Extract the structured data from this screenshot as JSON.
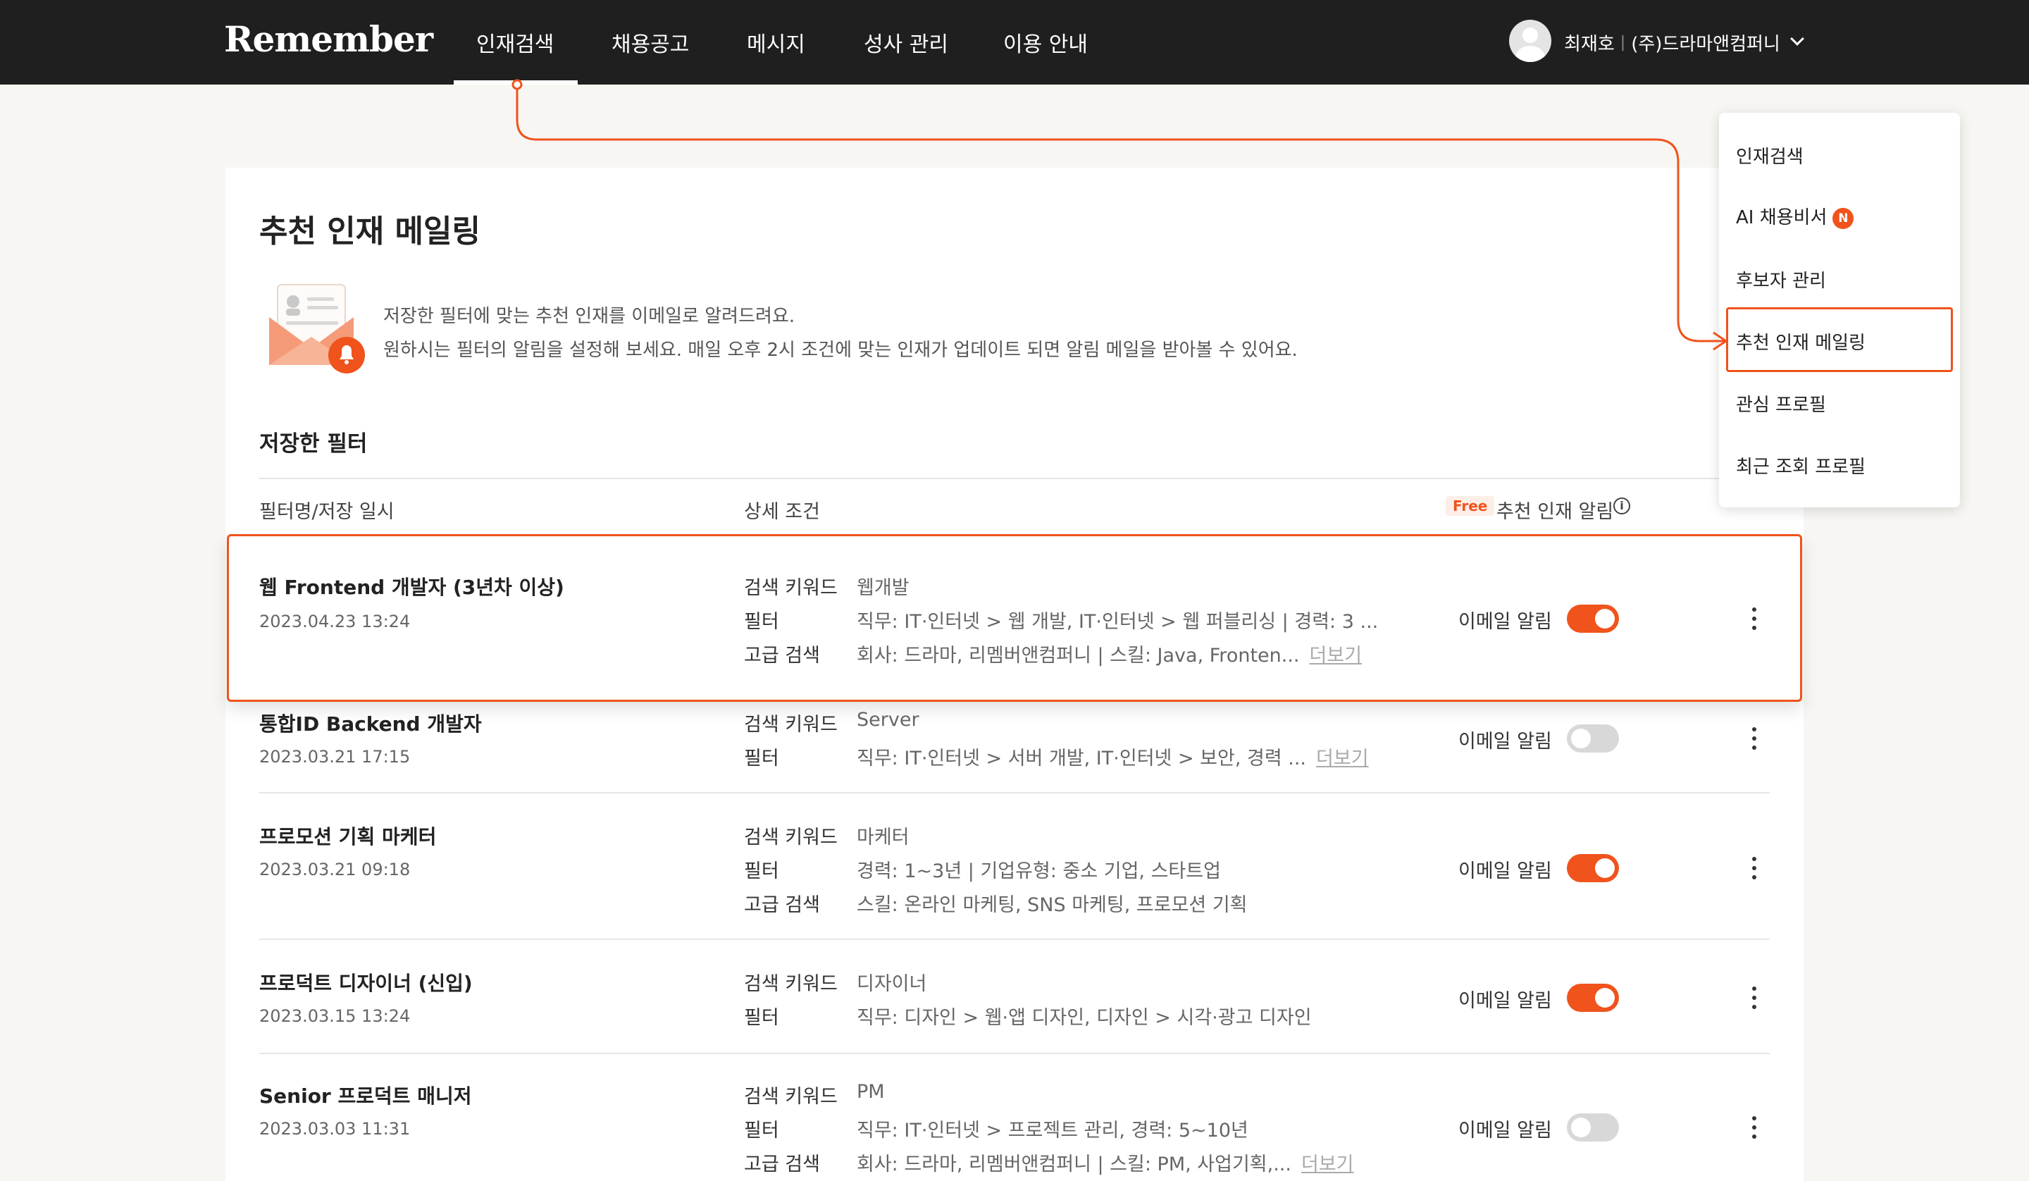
{
  "header": {
    "logo": "Remember",
    "nav": [
      {
        "label": "인재검색"
      },
      {
        "label": "채용공고"
      },
      {
        "label": "메시지"
      },
      {
        "label": "성사 관리"
      },
      {
        "label": "이용 안내"
      }
    ],
    "user": {
      "name": "최재호",
      "separator": "|",
      "company": "(주)드라마앤컴퍼니"
    }
  },
  "page": {
    "title": "추천 인재 메일링",
    "description_line1": "저장한 필터에 맞는 추천 인재를 이메일로 알려드려요.",
    "description_line2": "원하시는 필터의 알림을 설정해 보세요. 매일 오후 2시 조건에 맞는 인재가 업데이트 되면 알림 메일을 받아볼 수 있어요.",
    "section_title": "저장한 필터",
    "columns": {
      "name": "필터명/저장 일시",
      "detail": "상세 조건",
      "free_badge": "Free",
      "alarm": "추천 인재 알림",
      "info_icon": "i"
    }
  },
  "filters": [
    {
      "name": "웹 Frontend 개발자 (3년차 이상)",
      "date": "2023.04.23 13:24",
      "conditions": [
        {
          "key": "검색 키워드",
          "value": "웹개발"
        },
        {
          "key": "필터",
          "value": "직무: IT·인터넷 > 웹 개발, IT·인터넷 > 웹 퍼블리싱 | 경력: 3 ..."
        },
        {
          "key": "고급 검색",
          "value": "회사: 드라마, 리멤버앤컴퍼니 | 스킬: Java, Fronten...",
          "more": "더보기"
        }
      ],
      "alarm_label": "이메일 알림",
      "alarm_on": true
    },
    {
      "name": "통합ID Backend 개발자",
      "date": "2023.03.21 17:15",
      "conditions": [
        {
          "key": "검색 키워드",
          "value": "Server"
        },
        {
          "key": "필터",
          "value": "직무: IT·인터넷 > 서버 개발, IT·인터넷 > 보안, 경력 ...",
          "more": "더보기"
        }
      ],
      "alarm_label": "이메일 알림",
      "alarm_on": false
    },
    {
      "name": "프로모션 기획 마케터",
      "date": "2023.03.21 09:18",
      "conditions": [
        {
          "key": "검색 키워드",
          "value": "마케터"
        },
        {
          "key": "필터",
          "value": "경력: 1~3년 | 기업유형: 중소 기업, 스타트업"
        },
        {
          "key": "고급 검색",
          "value": "스킬: 온라인 마케팅, SNS 마케팅, 프로모션 기획"
        }
      ],
      "alarm_label": "이메일 알림",
      "alarm_on": true
    },
    {
      "name": "프로덕트 디자이너 (신입)",
      "date": "2023.03.15 13:24",
      "conditions": [
        {
          "key": "검색 키워드",
          "value": "디자이너"
        },
        {
          "key": "필터",
          "value": "직무: 디자인 > 웹·앱 디자인, 디자인 > 시각·광고 디자인"
        }
      ],
      "alarm_label": "이메일 알림",
      "alarm_on": true
    },
    {
      "name": "Senior 프로덕트 매니저",
      "date": "2023.03.03 11:31",
      "conditions": [
        {
          "key": "검색 키워드",
          "value": "PM"
        },
        {
          "key": "필터",
          "value": "직무:  IT·인터넷 > 프로젝트 관리, 경력: 5~10년"
        },
        {
          "key": "고급 검색",
          "value": "회사: 드라마, 리멤버앤컴퍼니 | 스킬: PM, 사업기획,...",
          "more": "더보기"
        }
      ],
      "alarm_label": "이메일 알림",
      "alarm_on": false
    }
  ],
  "dropdown": {
    "items": [
      {
        "label": "인재검색"
      },
      {
        "label": "AI 채용비서",
        "badge": "N"
      },
      {
        "label": "후보자 관리"
      },
      {
        "label": "추천 인재 메일링"
      },
      {
        "label": "관심 프로필"
      },
      {
        "label": "최근 조회 프로필"
      }
    ]
  },
  "colors": {
    "accent": "#f0531c",
    "header_bg": "#1f1f1f",
    "page_bg": "#f7f6f3"
  }
}
